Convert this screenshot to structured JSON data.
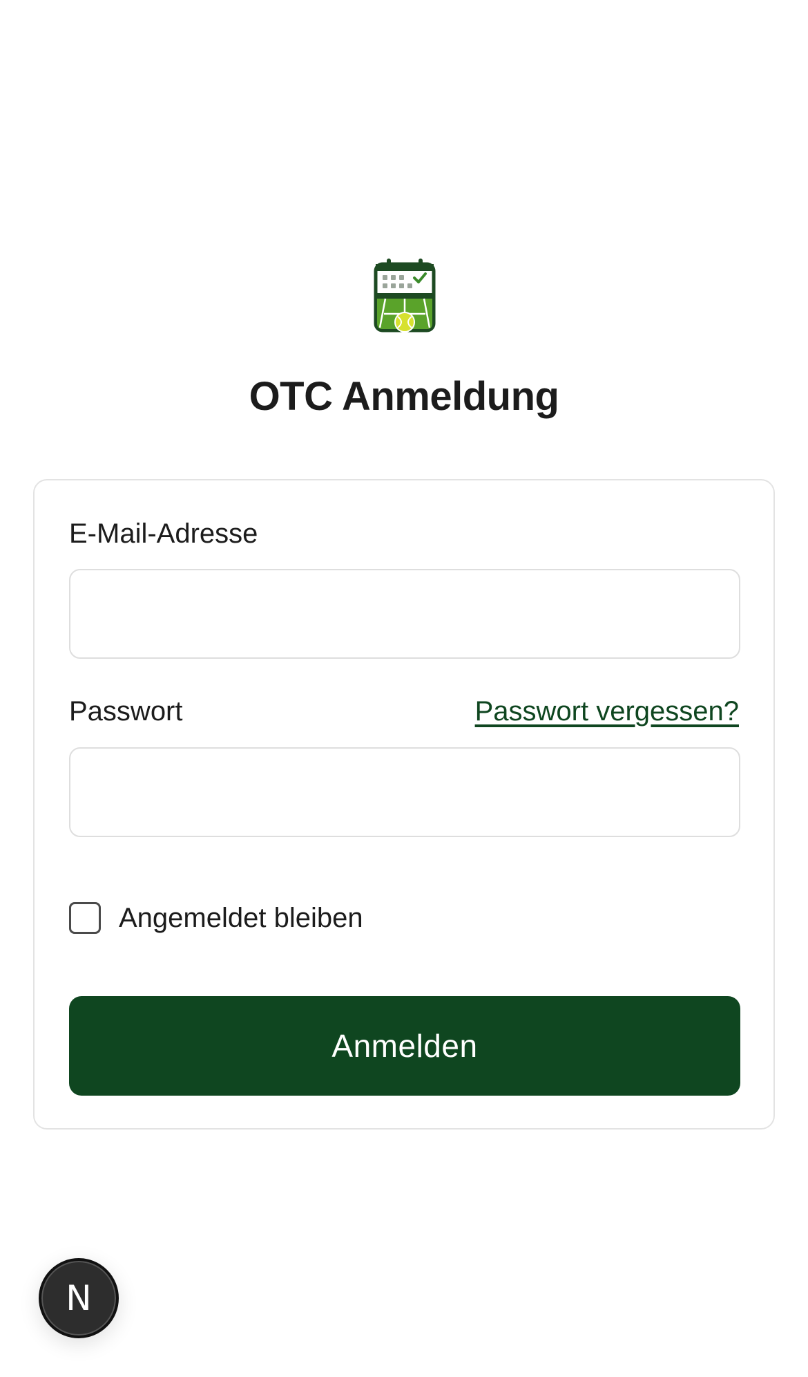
{
  "header": {
    "logo_icon": "tennis-calendar-icon",
    "title": "OTC Anmeldung"
  },
  "form": {
    "email": {
      "label": "E-Mail-Adresse",
      "value": "",
      "placeholder": ""
    },
    "password": {
      "label": "Passwort",
      "value": "",
      "placeholder": "",
      "forgot_link": "Passwort vergessen?"
    },
    "remember": {
      "label": "Angemeldet bleiben",
      "checked": false
    },
    "submit_label": "Anmelden"
  },
  "dev_badge": {
    "letter": "N",
    "icon": "nextjs-icon"
  },
  "colors": {
    "accent": "#0f4620",
    "court_green": "#5aa32a",
    "ball_yellow": "#d7e12e",
    "border": "#e3e3e3"
  }
}
